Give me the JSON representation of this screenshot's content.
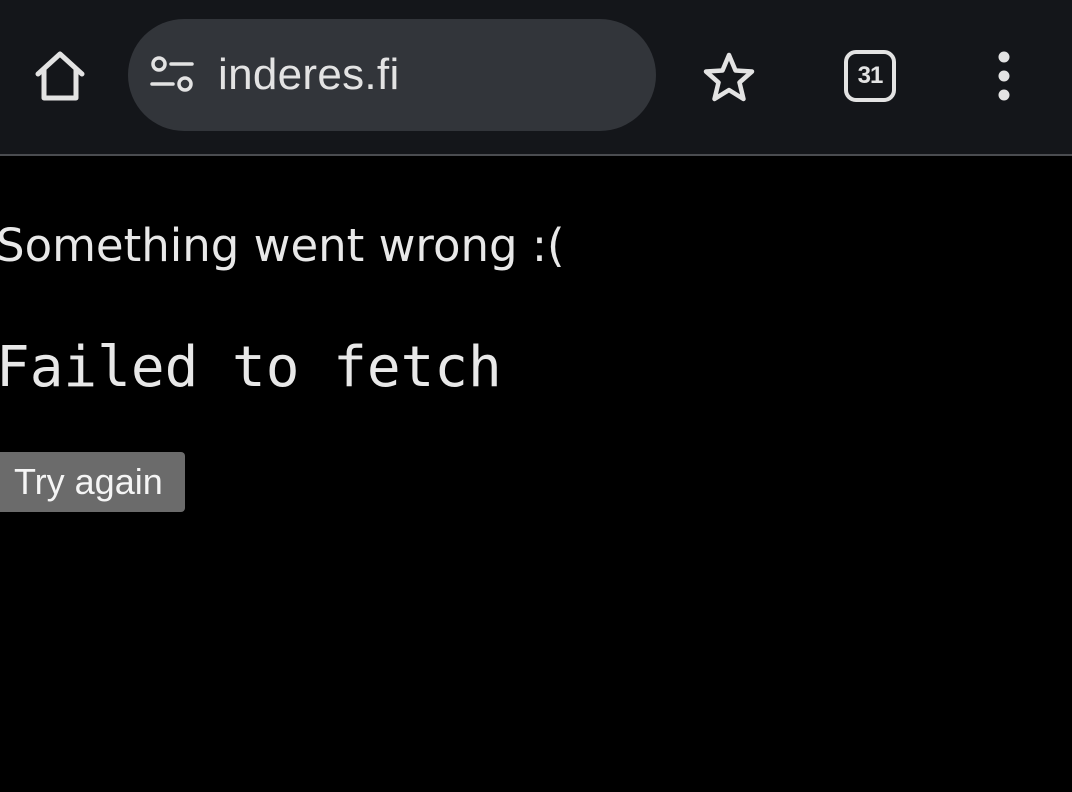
{
  "browser": {
    "url": "inderes.fi",
    "tab_count": "31",
    "icons": {
      "home": "home-icon",
      "site_info": "tune-icon",
      "bookmark": "star-icon",
      "tabs": "tab-switcher-icon",
      "menu": "more-vert-icon"
    },
    "colors": {
      "toolbar": "#14161a",
      "omnibox": "#32353a",
      "icon": "#e3e3e3"
    }
  },
  "page": {
    "title": "Something went wrong :(",
    "message": "Failed to fetch",
    "retry_label": "Try again",
    "colors": {
      "background": "#000000",
      "text": "#e8e8e8",
      "button": "#6b6b6b"
    }
  }
}
